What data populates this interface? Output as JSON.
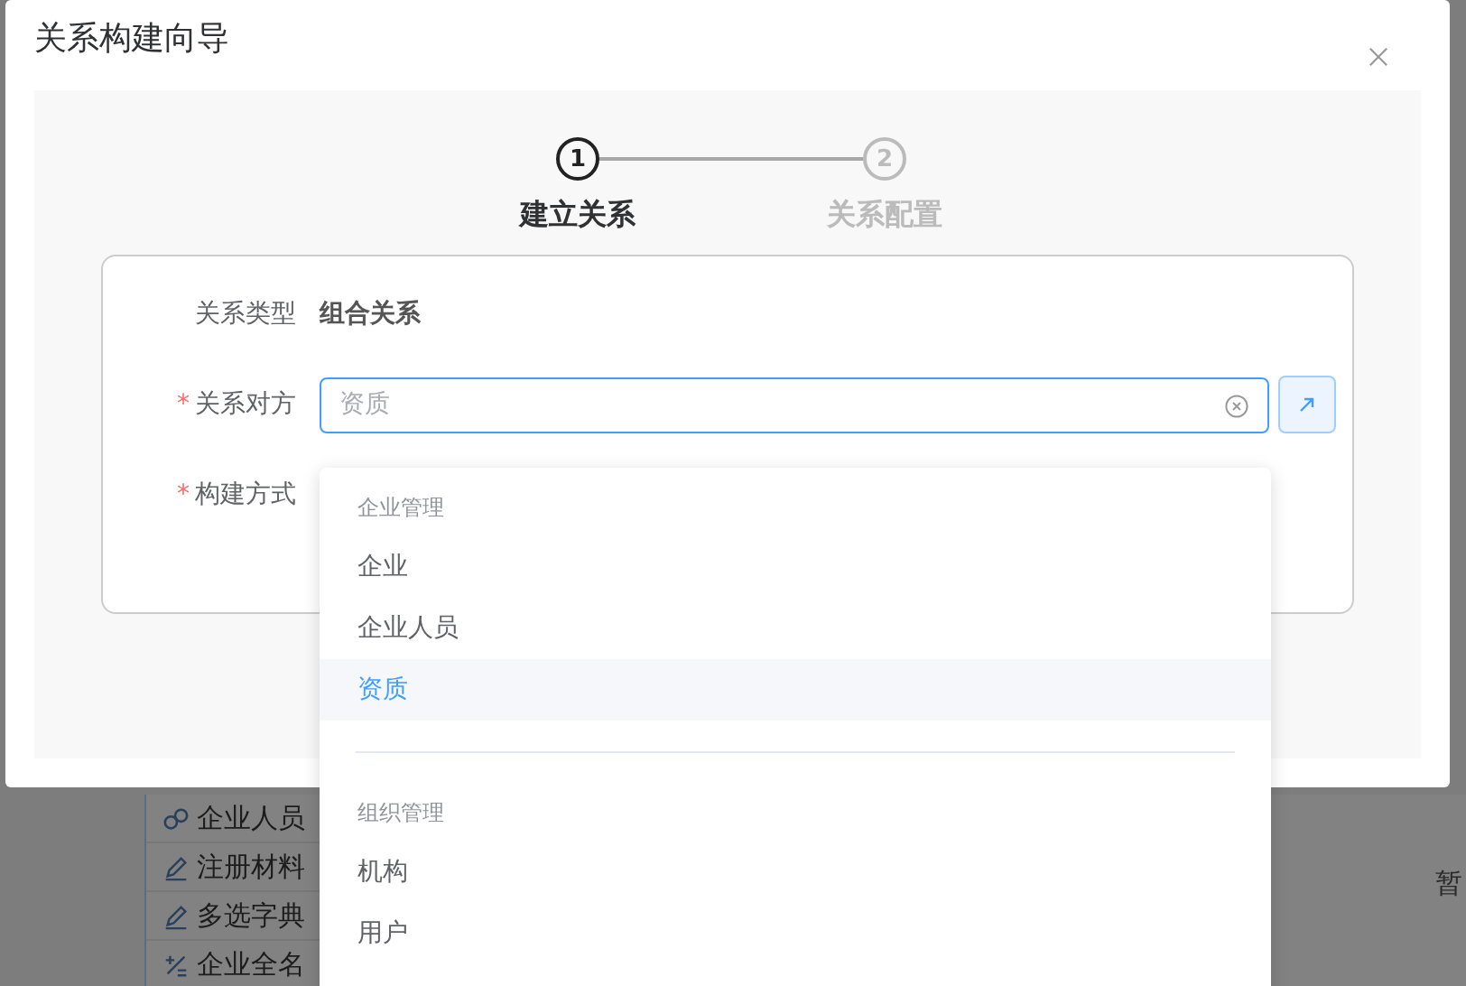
{
  "dialog": {
    "title": "关系构建向导"
  },
  "steps": [
    {
      "number": "1",
      "label": "建立关系",
      "selected": true
    },
    {
      "number": "2",
      "label": "关系配置",
      "selected": false
    }
  ],
  "form": {
    "fields": [
      {
        "kind": "text",
        "label": "关系类型",
        "value": "组合关系"
      },
      {
        "kind": "select",
        "label": "关系对方",
        "required_mark": "*",
        "placeholder": "资质"
      },
      {
        "kind": "empty",
        "label": "构建方式",
        "required_mark": "*"
      }
    ]
  },
  "dropdown": {
    "groups": [
      {
        "title": "企业管理",
        "options": [
          {
            "label": "企业",
            "selected": false
          },
          {
            "label": "企业人员",
            "selected": false
          },
          {
            "label": "资质",
            "selected": true
          }
        ]
      },
      {
        "title": "组织管理",
        "options": [
          {
            "label": "机构",
            "selected": false
          },
          {
            "label": "用户",
            "selected": false
          }
        ]
      }
    ]
  },
  "background": {
    "rows": [
      {
        "kind": "link",
        "label": "企业人员"
      },
      {
        "kind": "edit",
        "label": "注册材料"
      },
      {
        "kind": "edit",
        "label": "多选字典"
      },
      {
        "kind": "formula",
        "label": "企业全名"
      }
    ],
    "empty_text": "暂"
  }
}
